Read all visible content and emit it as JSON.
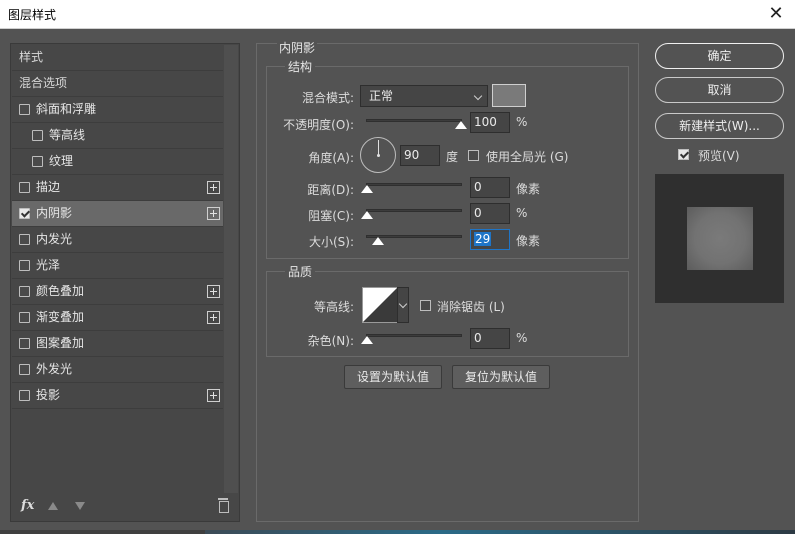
{
  "window": {
    "title": "图层样式",
    "close_glyph": "✕"
  },
  "left_panel": {
    "items": [
      {
        "label": "样式",
        "type": "header",
        "checkbox": false
      },
      {
        "label": "混合选项",
        "type": "header",
        "checkbox": false
      },
      {
        "label": "斜面和浮雕",
        "checked": false,
        "plus": false,
        "indent": 0
      },
      {
        "label": "等高线",
        "checked": false,
        "plus": false,
        "indent": 1
      },
      {
        "label": "纹理",
        "checked": false,
        "plus": false,
        "indent": 1
      },
      {
        "label": "描边",
        "checked": false,
        "plus": true,
        "indent": 0
      },
      {
        "label": "内阴影",
        "checked": true,
        "plus": true,
        "indent": 0,
        "selected": true
      },
      {
        "label": "内发光",
        "checked": false,
        "plus": false,
        "indent": 0
      },
      {
        "label": "光泽",
        "checked": false,
        "plus": false,
        "indent": 0
      },
      {
        "label": "颜色叠加",
        "checked": false,
        "plus": true,
        "indent": 0
      },
      {
        "label": "渐变叠加",
        "checked": false,
        "plus": true,
        "indent": 0
      },
      {
        "label": "图案叠加",
        "checked": false,
        "plus": false,
        "indent": 0
      },
      {
        "label": "外发光",
        "checked": false,
        "plus": false,
        "indent": 0
      },
      {
        "label": "投影",
        "checked": false,
        "plus": true,
        "indent": 0
      }
    ],
    "fx_label": "fx"
  },
  "inner_shadow": {
    "section_title": "内阴影",
    "structure": {
      "title": "结构",
      "blend_mode_label": "混合模式:",
      "blend_mode_value": "正常",
      "shadow_color": "#7a7a7a",
      "opacity_label": "不透明度(O):",
      "opacity_value": "100",
      "opacity_unit": "%",
      "opacity_level": 1.0,
      "angle_label": "角度(A):",
      "angle_value": "90",
      "angle_unit": "度",
      "global_light_label": "使用全局光 (G)",
      "global_light_checked": false,
      "distance_label": "距离(D):",
      "distance_value": "0",
      "distance_unit": "像素",
      "distance_level": 0.0,
      "choke_label": "阻塞(C):",
      "choke_value": "0",
      "choke_unit": "%",
      "choke_level": 0.0,
      "size_label": "大小(S):",
      "size_value": "29",
      "size_unit": "像素",
      "size_level": 0.12
    },
    "quality": {
      "title": "品质",
      "contour_label": "等高线:",
      "anti_alias_label": "消除锯齿 (L)",
      "anti_alias_checked": false,
      "noise_label": "杂色(N):",
      "noise_value": "0",
      "noise_unit": "%",
      "noise_level": 0.0
    },
    "set_default_label": "设置为默认值",
    "reset_default_label": "复位为默认值"
  },
  "right_panel": {
    "ok_label": "确定",
    "cancel_label": "取消",
    "new_style_label": "新建样式(W)...",
    "preview_label": "预览(V)",
    "preview_checked": true
  }
}
